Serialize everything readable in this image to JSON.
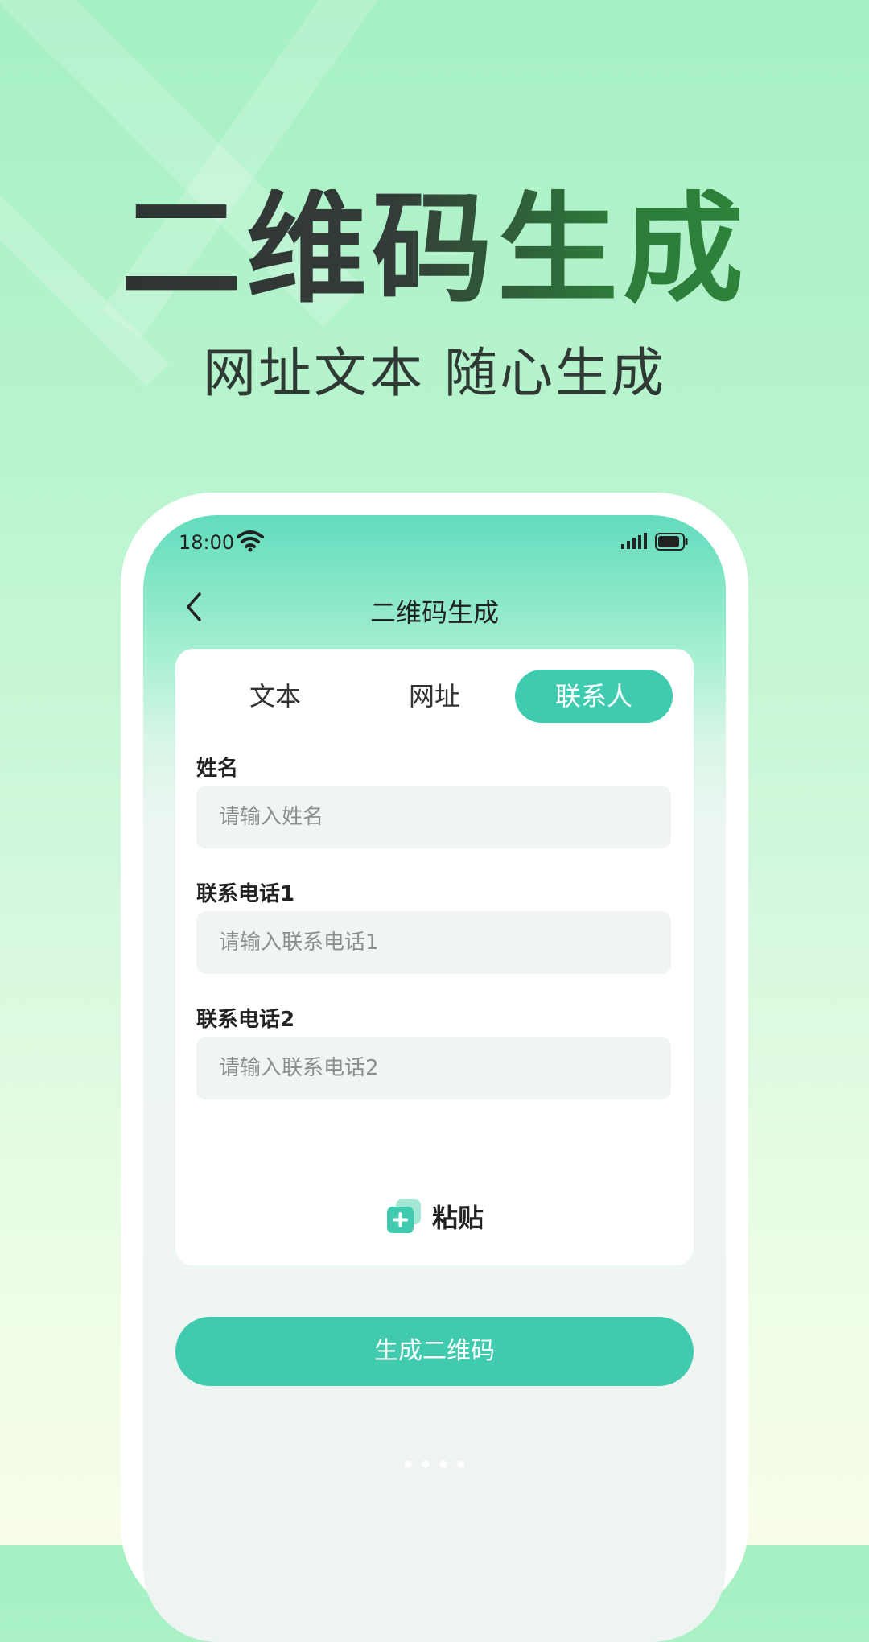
{
  "promo": {
    "headline": "二维码生成",
    "subheadline": "网址文本 随心生成"
  },
  "status_bar": {
    "time": "18:00"
  },
  "header": {
    "title": "二维码生成"
  },
  "tabs": [
    {
      "label": "文本"
    },
    {
      "label": "网址"
    },
    {
      "label": "联系人",
      "active": true
    }
  ],
  "form": {
    "fields": [
      {
        "label": "姓名",
        "value": "",
        "placeholder": "请输入姓名"
      },
      {
        "label": "联系电话1",
        "value": "",
        "placeholder": "请输入联系电话1"
      },
      {
        "label": "联系电话2",
        "value": "",
        "placeholder": "请输入联系电话2"
      }
    ],
    "paste_label": "粘贴"
  },
  "generate_label": "生成二维码",
  "pagination": {
    "total": 4,
    "current": 2
  },
  "colors": {
    "accent": "#41cbae",
    "headline_dark": "#2c3130",
    "headline_green": "#2e8b3a"
  }
}
